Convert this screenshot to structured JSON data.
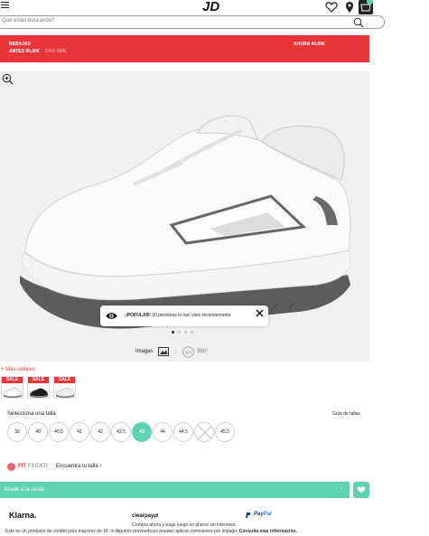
{
  "header": {
    "logo": "JD",
    "icons": [
      "menu-icon",
      "heart-icon",
      "location-pin-icon",
      "cart-icon"
    ]
  },
  "search": {
    "placeholder": "Qué estás buscando?"
  },
  "promo": {
    "label": "REBAJAS",
    "before": "ANTES 90,00€",
    "discount": "DTO: 56%",
    "now": "AHORA 40,00€",
    "color": "#e8353a"
  },
  "gallery": {
    "popular_label": "¡POPULAR!",
    "popular_text": "30 personas lo han visto recientemente",
    "image_count": 4,
    "active_image": 1,
    "images_label": "Images",
    "view_360_label": "360°"
  },
  "colors": {
    "more_label": "+ Más colores",
    "swatches": [
      {
        "badge": "SALE",
        "shoe": "white"
      },
      {
        "badge": "SALE",
        "shoe": "black"
      },
      {
        "badge": "SALE",
        "shoe": "white-grey"
      }
    ]
  },
  "sizes": {
    "title": "Selecciona una talla",
    "guide": "Guía de tallas",
    "options": [
      "39",
      "40",
      "40.5",
      "41",
      "42",
      "42.5",
      "43",
      "44",
      "44.5",
      "",
      "45.5"
    ],
    "selected": "43",
    "accent": "#5fd3b0"
  },
  "fit_finder": {
    "brand": "FIT",
    "brand_suffix": "FINDER",
    "link": "Encuentra tu talla ›"
  },
  "cart": {
    "add_label": "Añadir a la cesta",
    "chevron": "›"
  },
  "payments": {
    "klarna": "Klarna.",
    "clearpay": "clearpay",
    "paypal_a": "Pay",
    "paypal_b": "Pal",
    "note1": "Compra ahora y paga luego en plazos sin intereses.",
    "note2": "Este es un producto de crédito para mayores de 18. m Algunos proveedores pueden aplicar comisiones por impago.",
    "note2_link": "Consulta más información."
  }
}
